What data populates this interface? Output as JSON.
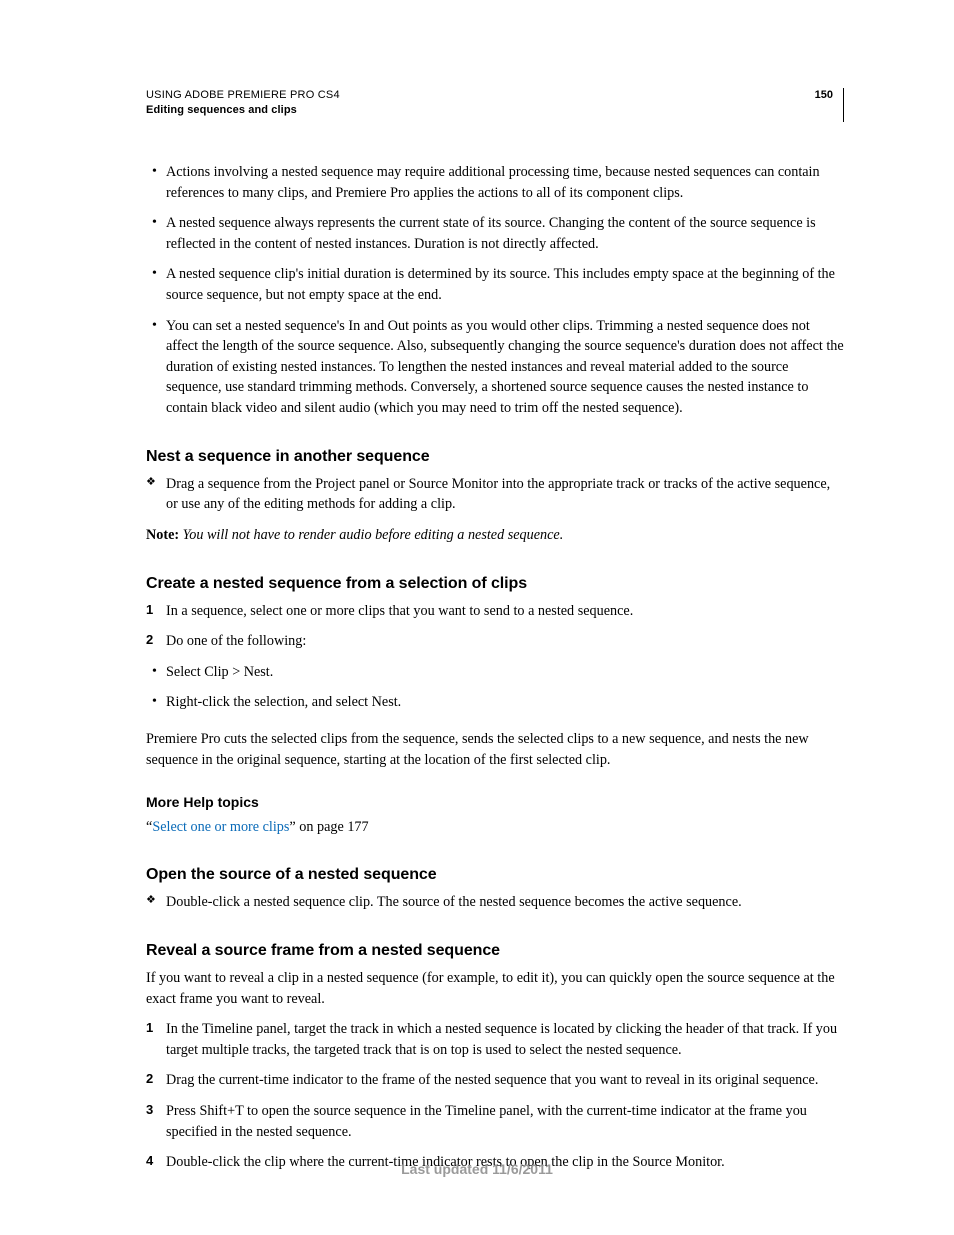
{
  "header": {
    "doc_title": "USING ADOBE PREMIERE PRO CS4",
    "section": "Editing sequences and clips",
    "page_number": "150"
  },
  "intro_bullets": [
    "Actions involving a nested sequence may require additional processing time, because nested sequences can contain references to many clips, and Premiere Pro applies the actions to all of its component clips.",
    "A nested sequence always represents the current state of its source. Changing the content of the source sequence is reflected in the content of nested instances. Duration is not directly affected.",
    "A nested sequence clip's initial duration is determined by its source. This includes empty space at the beginning of the source sequence, but not empty space at the end.",
    "You can set a nested sequence's In and Out points as you would other clips. Trimming a nested sequence does not affect the length of the source sequence. Also, subsequently changing the source sequence's duration does not affect the duration of existing nested instances. To lengthen the nested instances and reveal material added to the source sequence, use standard trimming methods. Conversely, a shortened source sequence causes the nested instance to contain black video and silent audio (which you may need to trim off the nested sequence)."
  ],
  "nest": {
    "heading": "Nest a sequence in another sequence",
    "step": "Drag a sequence from the Project panel or Source Monitor into the appropriate track or tracks of the active sequence, or use any of the editing methods for adding a clip.",
    "note_label": "Note:",
    "note_text": " You will not have to render audio before editing a nested sequence."
  },
  "create": {
    "heading": "Create a nested sequence from a selection of clips",
    "step1": "In a sequence, select one or more clips that you want to send to a nested sequence.",
    "step2": "Do one of the following:",
    "sub_bullets": [
      "Select Clip > Nest.",
      "Right-click the selection, and select Nest."
    ],
    "after": "Premiere Pro cuts the selected clips from the sequence, sends the selected clips to a new sequence, and nests the new sequence in the original sequence, starting at the location of the first selected clip."
  },
  "more_help": {
    "heading": "More Help topics",
    "quote_open": "“",
    "link_text": "Select one or more clips",
    "link_after": "” on page 177"
  },
  "open_source": {
    "heading": "Open the source of a nested sequence",
    "step": "Double-click a nested sequence clip. The source of the nested sequence becomes the active sequence."
  },
  "reveal": {
    "heading": "Reveal a source frame from a nested sequence",
    "intro": "If you want to reveal a clip in a nested sequence (for example, to edit it), you can quickly open the source sequence at the exact frame you want to reveal.",
    "steps": [
      "In the Timeline panel, target the track in which a nested sequence is located by clicking the header of that track. If you target multiple tracks, the targeted track that is on top is used to select the nested sequence.",
      "Drag the current-time indicator to the frame of the nested sequence that you want to reveal in its original sequence.",
      "Press Shift+T to open the source sequence in the Timeline panel, with the current-time indicator at the frame you specified in the nested sequence.",
      "Double-click the clip where the current-time indicator rests to open the clip in the Source Monitor."
    ]
  },
  "footer": "Last updated 11/6/2011"
}
